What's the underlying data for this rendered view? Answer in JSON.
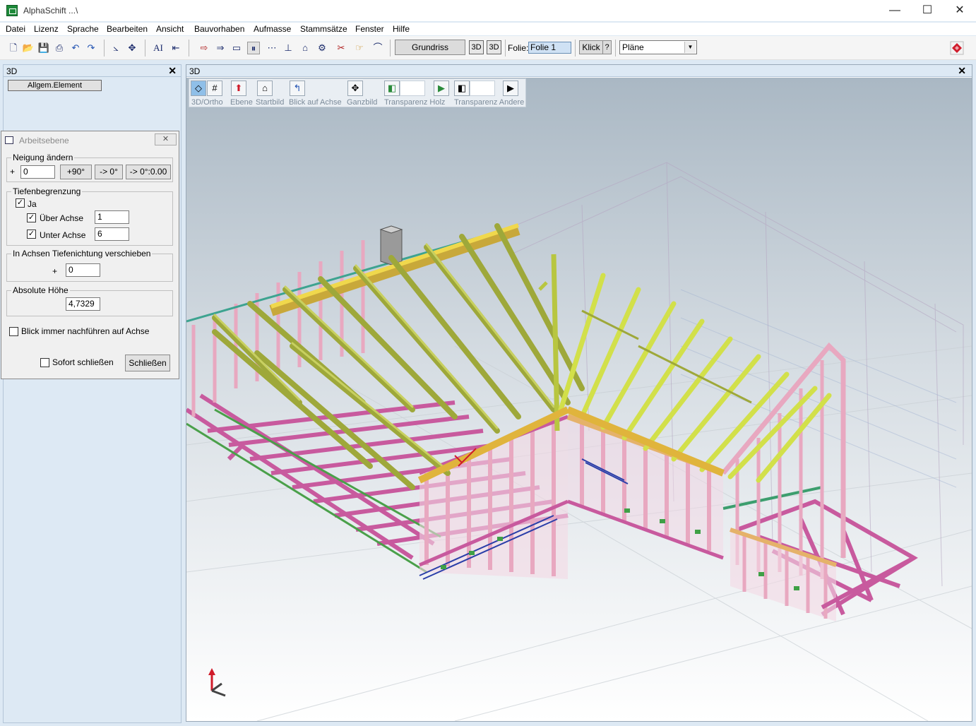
{
  "window": {
    "title": "AlphaSchift ...\\",
    "min": "—",
    "max": "☐",
    "close": "✕"
  },
  "menu": [
    "Datei",
    "Lizenz",
    "Sprache",
    "Bearbeiten",
    "Ansicht",
    "Bauvorhaben",
    "Aufmasse",
    "Stammsätze",
    "Fenster",
    "Hilfe"
  ],
  "toolbar": {
    "grundriss": "Grundriss",
    "btn3d_a": "3D",
    "btn3d_b": "3D",
    "folie_label": "Folie:",
    "folie_value": "Folie 1",
    "klick": "Klick",
    "klick_help": "?",
    "plaene": "Pläne"
  },
  "left_panel": {
    "title": "3D",
    "close": "✕",
    "allgem": "Allgem.Element"
  },
  "dialog": {
    "title": "Arbeitsebene",
    "close": "✕",
    "neigung": {
      "label": "Neigung ändern",
      "plus": "+",
      "value": "0",
      "btn_90": "+90°",
      "btn_0": "-> 0°",
      "btn_000": "-> 0°:0.00"
    },
    "tiefen": {
      "label": "Tiefenbegrenzung",
      "ja": "Ja",
      "ueber": "Über Achse",
      "ueber_value": "1",
      "unter": "Unter Achse",
      "unter_value": "6"
    },
    "achsen": {
      "label": "In Achsen Tiefenichtung verschieben",
      "plus": "+",
      "value": "0"
    },
    "hoehe": {
      "label": "Absolute Höhe",
      "value": "4,7329"
    },
    "blick": "Blick immer nachführen auf Achse",
    "sofort": "Sofort schließen",
    "schliessen": "Schließen"
  },
  "viewport": {
    "title": "3D",
    "close": "✕",
    "tools": [
      "3D/Ortho",
      "Ebene",
      "Startbild",
      "Blick auf Achse",
      "Ganzbild",
      "Transparenz Holz",
      "Transparenz Andere"
    ]
  }
}
